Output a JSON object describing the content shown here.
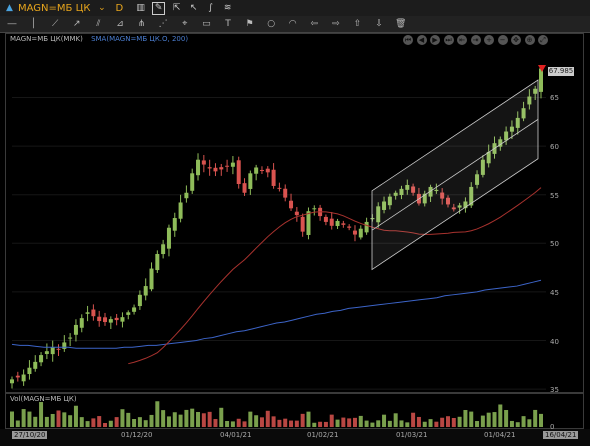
{
  "header": {
    "symbol": "MAGN=МБ ЦК",
    "period": "D"
  },
  "chart": {
    "legend_price": "MAGN=МБ ЦК(MMK)",
    "legend_sma": "SMA(MAGN=МБ ЦК.O, 200)",
    "legend_volume": "Vol(MAGN=МБ ЦК)",
    "last_price": "67.985",
    "y_ticks": [
      "65",
      "60",
      "55",
      "50",
      "45",
      "40",
      "35"
    ],
    "volume_zero": "0",
    "x_labels": [
      "27/10/20",
      "01/12/20",
      "04/01/21",
      "01/02/21",
      "01/03/21",
      "01/04/21",
      "16/04/21"
    ],
    "colors": {
      "up": "#8fbc5a",
      "down": "#d9534f",
      "sma": "#3c64c8",
      "ma": "#a8322e",
      "channel": "#cccccc",
      "accent": "#e7a51c"
    }
  },
  "chart_data": {
    "type": "candlestick",
    "x_range": [
      "27/10/20",
      "16/04/21"
    ],
    "ylim": [
      34,
      70
    ],
    "y_ticks": [
      35,
      40,
      45,
      50,
      55,
      60,
      65
    ],
    "last": 67.985,
    "close": [
      36.0,
      36.2,
      36.5,
      37.2,
      37.8,
      38.5,
      38.9,
      39.3,
      39.1,
      39.8,
      40.3,
      41.6,
      42.3,
      42.9,
      42.5,
      42.0,
      41.9,
      42.2,
      42.1,
      42.4,
      42.9,
      43.4,
      44.7,
      45.6,
      47.4,
      48.9,
      49.9,
      51.6,
      52.6,
      54.2,
      55.2,
      57.2,
      58.6,
      58.1,
      57.7,
      57.4,
      57.6,
      57.9,
      58.3,
      56.1,
      55.2,
      57.2,
      57.8,
      57.5,
      57.3,
      55.9,
      55.6,
      54.7,
      53.6,
      52.9,
      51.2,
      53.3,
      53.6,
      52.8,
      52.2,
      51.8,
      52.3,
      51.9,
      51.6,
      50.9,
      51.5,
      52.2,
      52.6,
      53.8,
      54.3,
      54.8,
      55.2,
      55.6,
      56.0,
      55.2,
      54.1,
      55.1,
      55.8,
      55.5,
      54.6,
      54.0,
      53.5,
      53.9,
      54.3,
      55.8,
      57.1,
      58.6,
      59.4,
      60.3,
      60.7,
      61.5,
      62.0,
      62.9,
      63.9,
      65.1,
      65.9,
      67.985
    ],
    "sma200": [
      39.6,
      39.5,
      39.5,
      39.4,
      39.3,
      39.3,
      39.3,
      39.3,
      39.2,
      39.2,
      39.2,
      39.2,
      39.2,
      39.2,
      39.3,
      39.3,
      39.4,
      39.5,
      39.5,
      39.6,
      39.7,
      39.8,
      39.9,
      40.0,
      40.2,
      40.3,
      40.5,
      40.7,
      40.9,
      41.0,
      41.2,
      41.4,
      41.6,
      41.8,
      41.9,
      42.1,
      42.3,
      42.5,
      42.7,
      42.8,
      43.0,
      43.1,
      43.3,
      43.4,
      43.5,
      43.6,
      43.7,
      43.8,
      43.9,
      44.0,
      44.1,
      44.2,
      44.3,
      44.4,
      44.6,
      44.7,
      44.8,
      44.9,
      45.0,
      45.2,
      45.3,
      45.4,
      45.5,
      45.6,
      45.8,
      46.0,
      46.2
    ],
    "ma_red_start_index": 20,
    "channel": {
      "start": "25/02/21",
      "end": "13/04/21",
      "lower_start": 47.3,
      "lower_end": 58.7,
      "upper_start": 55.4,
      "upper_end": 66.8
    },
    "volume_ylim": [
      0,
      1
    ]
  }
}
